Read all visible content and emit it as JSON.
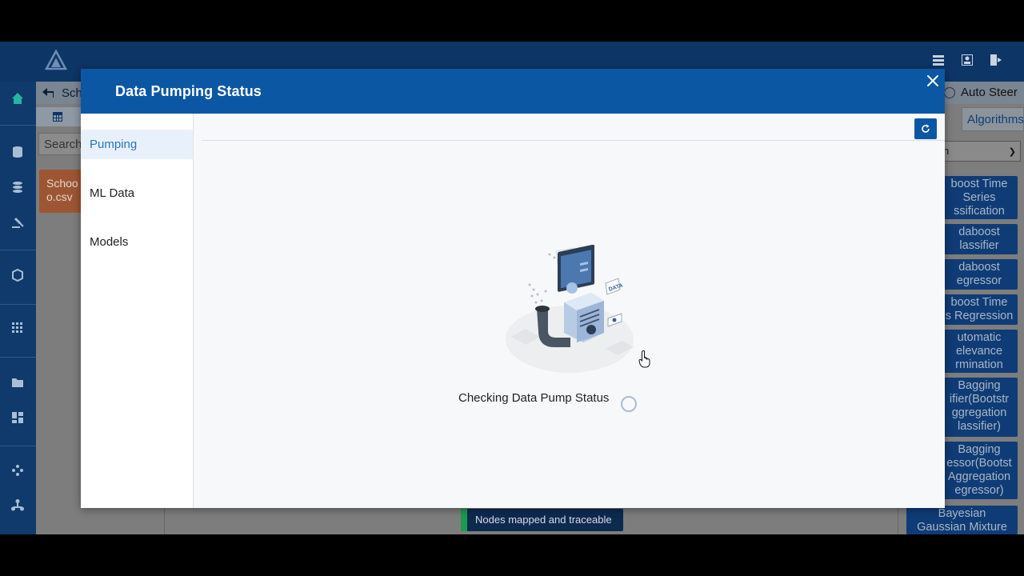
{
  "modal": {
    "title": "Data Pumping Status",
    "sidebar": [
      {
        "label": "Pumping",
        "active": true
      },
      {
        "label": "ML Data",
        "active": false
      },
      {
        "label": "Models",
        "active": false
      }
    ],
    "status_text": "Checking Data Pump Status",
    "illustration_label": "DATA"
  },
  "background": {
    "header_text": "Sch",
    "search_placeholder": "Search",
    "file_card": [
      "Schoo",
      "o.csv"
    ],
    "right_header": "Auto Steer",
    "right_tab": "Algorithms",
    "right_select": "n",
    "algorithms": [
      [
        "boost Time",
        "Series",
        "ssification"
      ],
      [
        "daboost",
        "lassifier"
      ],
      [
        "daboost",
        "egressor"
      ],
      [
        "boost Time",
        "s Regression"
      ],
      [
        "utomatic",
        "elevance",
        "rmination"
      ],
      [
        "Bagging",
        "ifier(Bootstr",
        "ggregation",
        "lassifier)"
      ],
      [
        "Bagging",
        "essor(Bootst",
        "Aggregation",
        "egressor)"
      ],
      [
        "Bayesian",
        "Gaussian Mixture"
      ]
    ],
    "toast": "Nodes mapped and traceable"
  },
  "colors": {
    "header_blue": "#0b57a4",
    "active_text": "#2a73c6",
    "nav_dark": "#0f3a6b",
    "toast_accent": "#1c9a4f"
  },
  "icons": [
    "logo-icon",
    "list-icon",
    "user-icon",
    "logout-icon",
    "home-icon",
    "database-icon",
    "layers-icon",
    "gavel-icon",
    "cube-icon",
    "grid-icon",
    "folder-icon",
    "dashboard-icon",
    "network-icon",
    "share-icon",
    "close-icon",
    "refresh-icon",
    "pointer-cursor-icon"
  ]
}
